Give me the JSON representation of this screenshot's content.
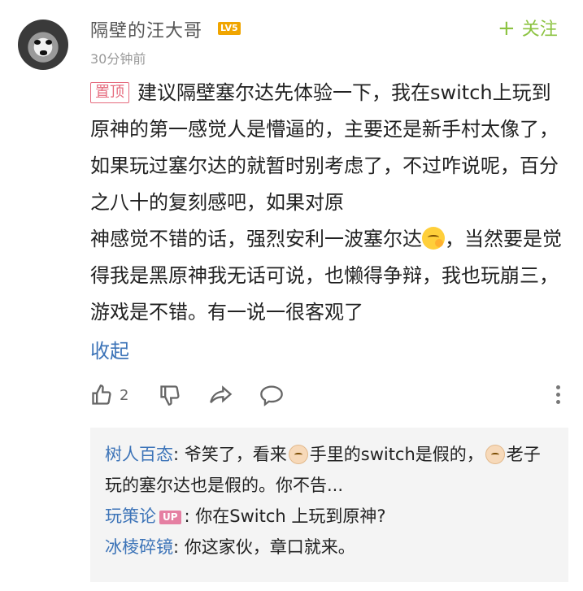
{
  "comment": {
    "username": "隔壁的汪大哥",
    "level_badge": "LV5",
    "timestamp": "30分钟前",
    "follow_label": "关注",
    "pin_tag": "置顶",
    "paragraph_1": "建议隔壁塞尔达先体验一下，我在switch上玩到原神的第一感觉人是懵逼的，主要还是新手村太像了，如果玩过塞尔达的就暂时别考虑了，不过咋说呢，百分之八十的复刻感吧，如果对原",
    "paragraph_2a": "神感觉不错的话，强烈安利一波塞尔达",
    "paragraph_2b": "，当然要是觉得我是黑原神我无话可说，也懒得争辩，我也玩崩三，游戏是不错。有一说一很客观了",
    "collapse_label": "收起"
  },
  "actions": {
    "like_count": "2",
    "icons": [
      "thumbs-up-icon",
      "thumbs-down-icon",
      "share-icon",
      "comment-icon",
      "more-icon"
    ]
  },
  "replies": [
    {
      "name": "树人百态",
      "text_a": ": 爷笑了，看来",
      "text_b": "手里的switch是假的，",
      "text_c": "老子玩的塞尔达也是假的。你不告..."
    },
    {
      "name": "玩策论",
      "badge": "UP",
      "text": ": 你在Switch 上玩到原神?"
    },
    {
      "name": "冰棱碎镜",
      "text": ": 你这家伙，章口就来。"
    }
  ],
  "colors": {
    "accent_green": "#8cc341",
    "link_blue": "#3d74b8",
    "pin_pink": "#e56b7e",
    "level_orange": "#f0a500"
  }
}
